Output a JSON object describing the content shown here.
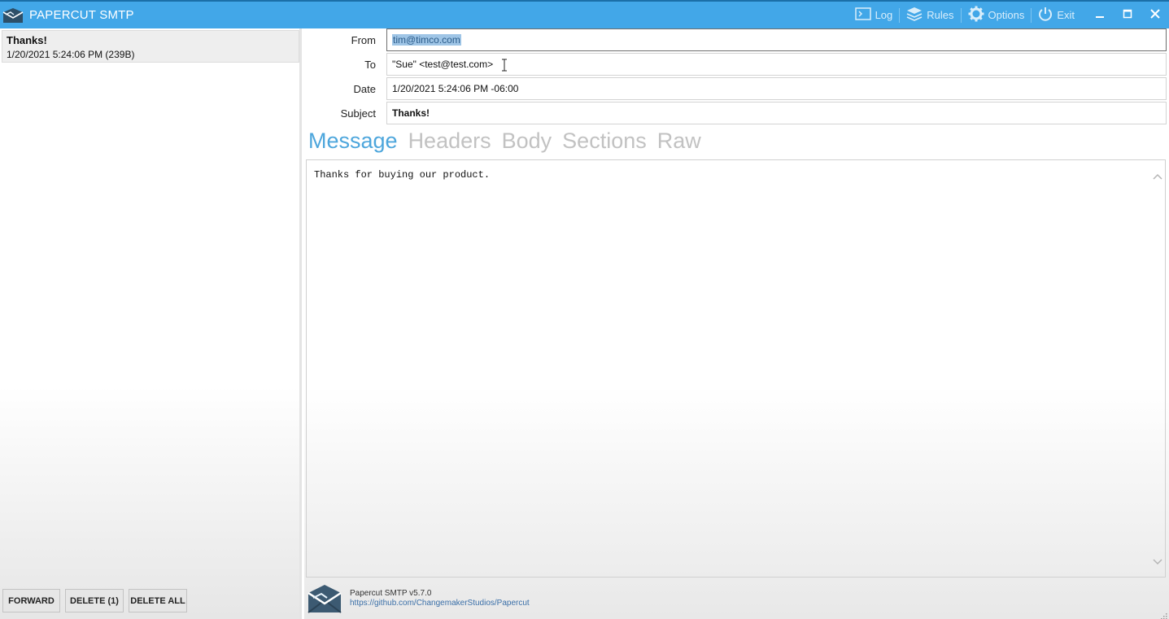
{
  "window": {
    "title": "PAPERCUT SMTP",
    "actions": [
      {
        "label": "Log",
        "icon": "terminal-icon"
      },
      {
        "label": "Rules",
        "icon": "layers-icon"
      },
      {
        "label": "Options",
        "icon": "gear-icon"
      },
      {
        "label": "Exit",
        "icon": "power-icon"
      }
    ]
  },
  "messages": [
    {
      "subject": "Thanks!",
      "meta": "1/20/2021 5:24:06 PM (239B)"
    }
  ],
  "left_buttons": {
    "forward": "FORWARD",
    "delete": "DELETE (1)",
    "delete_all": "DELETE ALL"
  },
  "fields": {
    "from": {
      "label": "From",
      "value": "tim@timco.com"
    },
    "to": {
      "label": "To",
      "value": "\"Sue\" <test@test.com>"
    },
    "date": {
      "label": "Date",
      "value": "1/20/2021 5:24:06 PM -06:00"
    },
    "subject": {
      "label": "Subject",
      "value": "Thanks!"
    }
  },
  "tabs": [
    "Message",
    "Headers",
    "Body",
    "Sections",
    "Raw"
  ],
  "active_tab": "Message",
  "body_text": "Thanks for buying our product.",
  "footer": {
    "version": "Papercut SMTP v5.7.0",
    "link": "https://github.com/ChangemakerStudios/Papercut"
  },
  "colors": {
    "titlebar": "#42a7e8",
    "active_tab": "#4da6dc",
    "inactive_tab": "#c2c2c2"
  }
}
